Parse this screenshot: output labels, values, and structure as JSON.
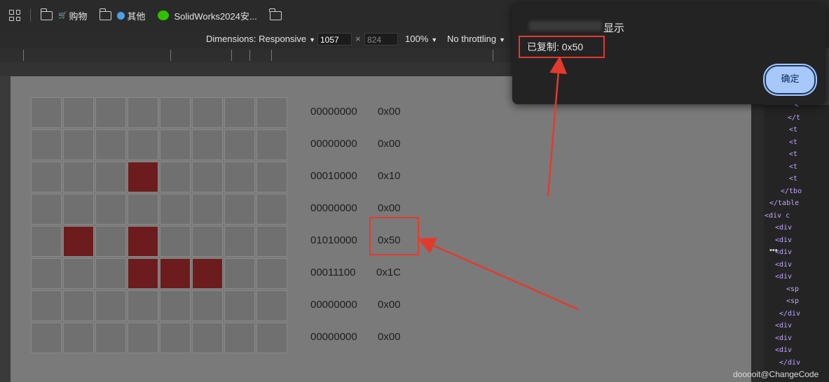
{
  "bookmarks": [
    {
      "label": "购物",
      "icon": "folder-icon"
    },
    {
      "label": "其他",
      "icon": "folder-icon"
    },
    {
      "label": "SolidWorks2024安...",
      "icon": "wechat-icon"
    },
    {
      "label": "",
      "icon": "folder-icon"
    }
  ],
  "devtools": {
    "dimensions_label": "Dimensions: Responsive",
    "width": "1057",
    "times": "×",
    "height": "824",
    "zoom": "100%",
    "throttling": "No throttling"
  },
  "matrix": {
    "rows": [
      {
        "bits": "00000000",
        "hex": "0x00",
        "cells": [
          0,
          0,
          0,
          0,
          0,
          0,
          0,
          0
        ]
      },
      {
        "bits": "00000000",
        "hex": "0x00",
        "cells": [
          0,
          0,
          0,
          0,
          0,
          0,
          0,
          0
        ]
      },
      {
        "bits": "00010000",
        "hex": "0x10",
        "cells": [
          0,
          0,
          0,
          1,
          0,
          0,
          0,
          0
        ]
      },
      {
        "bits": "00000000",
        "hex": "0x00",
        "cells": [
          0,
          0,
          0,
          0,
          0,
          0,
          0,
          0
        ]
      },
      {
        "bits": "01010000",
        "hex": "0x50",
        "cells": [
          0,
          1,
          0,
          1,
          0,
          0,
          0,
          0
        ]
      },
      {
        "bits": "00011100",
        "hex": "0x1C",
        "cells": [
          0,
          0,
          0,
          1,
          1,
          1,
          0,
          0
        ]
      },
      {
        "bits": "00000000",
        "hex": "0x00",
        "cells": [
          0,
          0,
          0,
          0,
          0,
          0,
          0,
          0
        ]
      },
      {
        "bits": "00000000",
        "hex": "0x00",
        "cells": [
          0,
          0,
          0,
          0,
          0,
          0,
          0,
          0
        ]
      }
    ],
    "on_color": "#6c1c1c",
    "off_color": "#707070"
  },
  "dialog": {
    "origin_suffix": "显示",
    "message": "已复制: 0x50",
    "ok_label": "确定"
  },
  "elements_panel": [
    "<",
    "<",
    "<",
    "</t",
    "<t",
    "<t",
    "<t",
    "<t",
    "<t",
    "</tbo",
    "</table",
    "<div c",
    "<div",
    "<div",
    "<div",
    "<div",
    "<div",
    "<sp",
    "<sp",
    "</div",
    "<div",
    "<div",
    "<div",
    "</div"
  ],
  "watermark": "dooooit@ChangeCode",
  "annotation_color": "#e23b2e"
}
